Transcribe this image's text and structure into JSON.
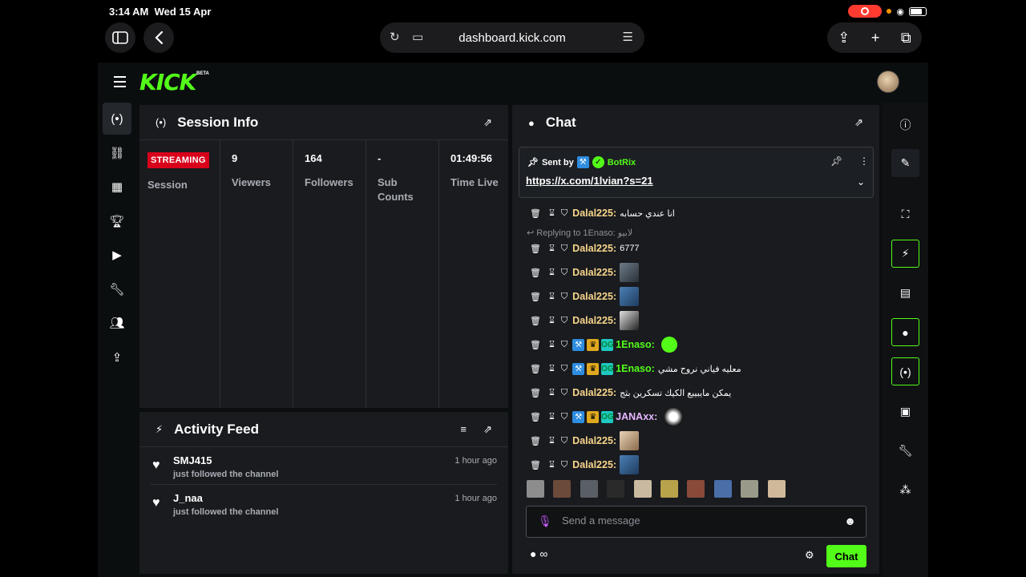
{
  "status": {
    "time": "3:14 AM",
    "date": "Wed 15 Apr"
  },
  "browser": {
    "url": "dashboard.kick.com"
  },
  "brand": {
    "logo": "KICK",
    "beta": "BETA",
    "accent": "#53fc18"
  },
  "nav": {
    "items": [
      {
        "icon": "broadcast-icon"
      },
      {
        "icon": "link-icon"
      },
      {
        "icon": "analytics-icon"
      },
      {
        "icon": "trophy-icon"
      },
      {
        "icon": "video-icon"
      },
      {
        "icon": "wrench-icon"
      },
      {
        "icon": "users-icon"
      },
      {
        "icon": "upload-icon"
      }
    ]
  },
  "session": {
    "title": "Session Info",
    "status_badge": "STREAMING",
    "status_label": "Session",
    "viewers": "9",
    "viewers_label": "Viewers",
    "followers": "164",
    "followers_label": "Followers",
    "subs": "-",
    "subs_label": "Sub Counts",
    "time_live": "01:49:56",
    "time_live_label": "Time Live"
  },
  "activity": {
    "title": "Activity Feed",
    "items": [
      {
        "user": "SMJ415",
        "action": "just followed the channel",
        "time": "1 hour ago"
      },
      {
        "user": "J_naa",
        "action": "just followed the channel",
        "time": "1 hour ago"
      }
    ]
  },
  "chat": {
    "title": "Chat",
    "pinned": {
      "sent_by": "Sent by",
      "author": "BotRix",
      "link": "https://x.com/1lvian?s=21"
    },
    "reply_context": "Replying to 1Enaso: لابيو",
    "messages": [
      {
        "user": "Dalal225:",
        "text": "انا عندي حسابه"
      },
      {
        "user": "Dalal225:",
        "text": "6777"
      },
      {
        "user": "Dalal225:",
        "text": ""
      },
      {
        "user": "Dalal225:",
        "text": ""
      },
      {
        "user": "Dalal225:",
        "text": ""
      },
      {
        "user": "1Enaso:",
        "text": ""
      },
      {
        "user": "1Enaso:",
        "text": "معليه فياني نروح مشي"
      },
      {
        "user": "Dalal225:",
        "text": "يمكن مايبيبع الكيك تسكرين بثج"
      },
      {
        "user": "JANAxx:",
        "text": ""
      },
      {
        "user": "Dalal225:",
        "text": ""
      },
      {
        "user": "Dalal225:",
        "text": ""
      }
    ],
    "input_placeholder": "Send a message",
    "send_label": "Chat",
    "infinity": "∞"
  }
}
